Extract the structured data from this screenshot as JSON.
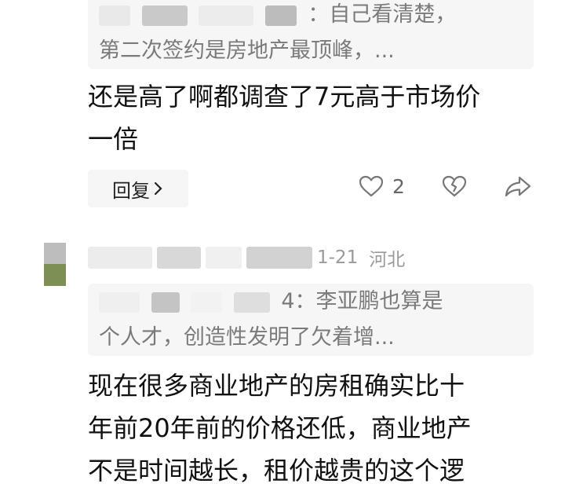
{
  "comment1": {
    "quote_line1": "：自己看清楚，",
    "quote_line2": "第二次签约是房地产最顶峰，...",
    "text_line1": "还是高了啊都调查了7元高于市场价",
    "text_line2": "一倍",
    "reply_label": "回复",
    "like_count": "2"
  },
  "comment2": {
    "date": "1-21",
    "location": "河北",
    "quote_line1": "4：李亚鹏也算是",
    "quote_line2": "个人才，创造性发明了欠着增...",
    "text_line1": "现在很多商业地产的房租确实比十",
    "text_line2": "年前20年前的价格还低，商业地产",
    "text_line3": "不是时间越长，租价越贵的这个逻"
  },
  "icons": {
    "like": "heart-icon",
    "dislike": "broken-heart-icon",
    "share": "share-arrow-icon",
    "reply_chevron": "chevron-right-icon"
  },
  "colors": {
    "quote_bg": "#f6f6f6",
    "quote_text": "#7a7a7a",
    "body_text": "#111111",
    "meta_text": "#9a9a9a"
  }
}
